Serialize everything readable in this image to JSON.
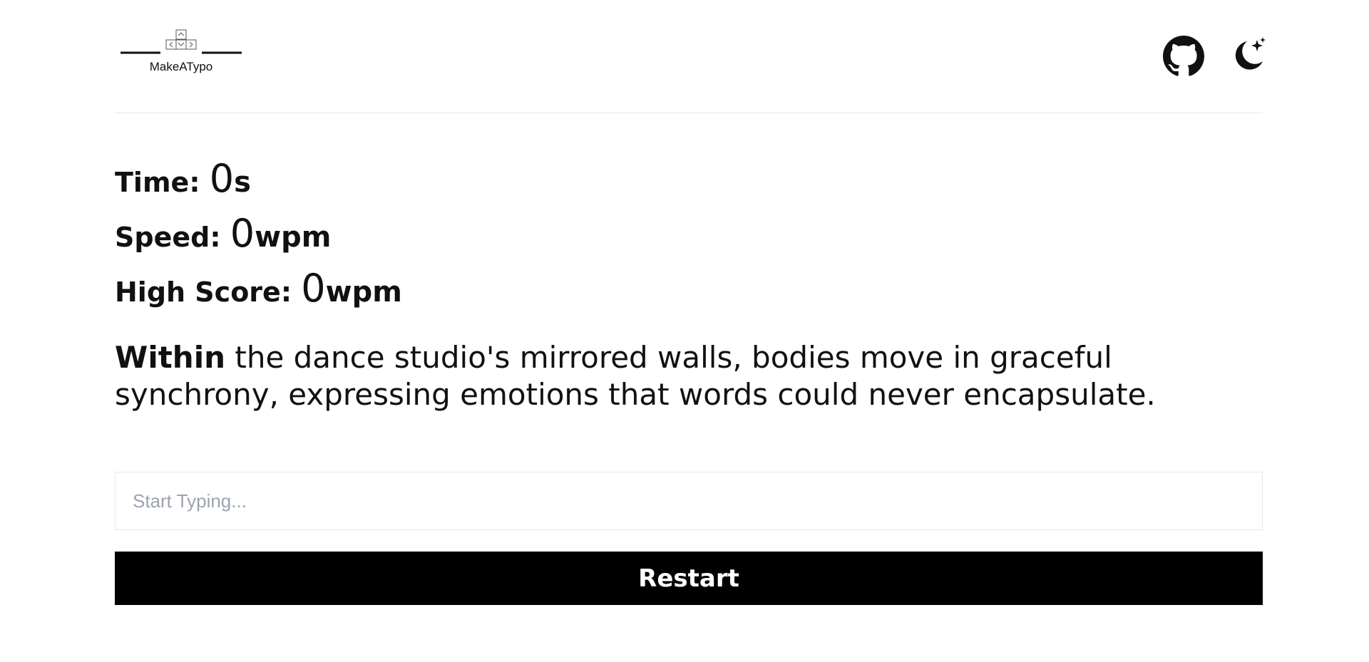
{
  "header": {
    "logo_text": "MakeATypo",
    "github_icon": "github-icon",
    "theme_icon": "moon-stars-icon"
  },
  "stats": {
    "time": {
      "label": "Time: ",
      "value": "0",
      "unit": "s"
    },
    "speed": {
      "label": "Speed: ",
      "value": "0",
      "unit": "wpm"
    },
    "high_score": {
      "label": "High Score: ",
      "value": "0",
      "unit": "wpm"
    }
  },
  "passage": {
    "current_word": "Within",
    "rest": " the dance studio's mirrored walls, bodies move in graceful synchrony, expressing emotions that words could never encapsulate."
  },
  "input": {
    "placeholder": "Start Typing...",
    "value": ""
  },
  "restart_label": "Restart",
  "colors": {
    "background": "#ffffff",
    "text": "#111111",
    "button_bg": "#000000",
    "button_text": "#ffffff",
    "border": "#e5e7eb",
    "placeholder": "#9ca3af"
  }
}
